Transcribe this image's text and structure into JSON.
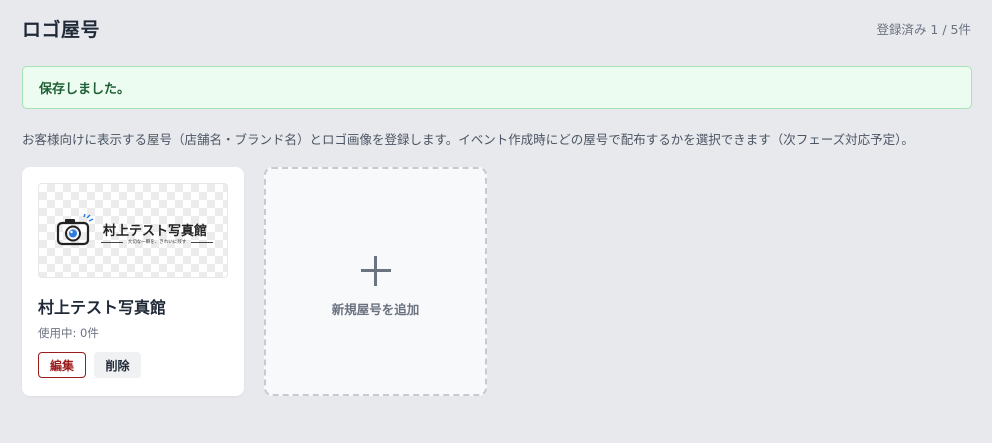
{
  "header": {
    "title": "ロゴ屋号",
    "count": "登録済み 1 / 5件"
  },
  "notice": {
    "message": "保存しました。"
  },
  "description": "お客様向けに表示する屋号（店舗名・ブランド名）とロゴ画像を登録します。イベント作成時にどの屋号で配布するかを選択できます（次フェーズ対応予定）。",
  "cards": [
    {
      "logo_text": "村上テスト写真館",
      "logo_tagline": "大切な一瞬を、きれいに残す",
      "name": "村上テスト写真館",
      "usage": "使用中: 0件",
      "edit_label": "編集",
      "delete_label": "削除"
    }
  ],
  "add_card": {
    "label": "新規屋号を追加",
    "icon": "plus-icon"
  },
  "colors": {
    "background": "#e8e9ed",
    "notice_bg": "#edfcf1",
    "notice_border": "#a7e3b7",
    "notice_text": "#1f5f36",
    "edit_accent": "#9b1c1c",
    "logo_blue": "#2a7de1"
  }
}
